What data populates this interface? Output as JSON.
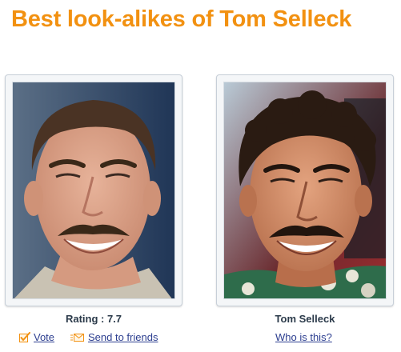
{
  "page": {
    "title": "Best look-alikes of Tom Selleck"
  },
  "lookalike": {
    "photo_icon": "lookalike-face-photo",
    "rating_label": "Rating : 7.7",
    "vote_label": "Vote",
    "vote_icon": "checkbox-check-icon",
    "send_label": "Send to friends",
    "send_icon": "envelope-icon"
  },
  "celebrity": {
    "photo_icon": "celebrity-face-photo",
    "name": "Tom Selleck",
    "who_label": "Who is this?"
  },
  "colors": {
    "title": "#f29111",
    "link": "#2d3f90",
    "caption": "#2b3a4a",
    "icon_orange": "#f29111"
  }
}
